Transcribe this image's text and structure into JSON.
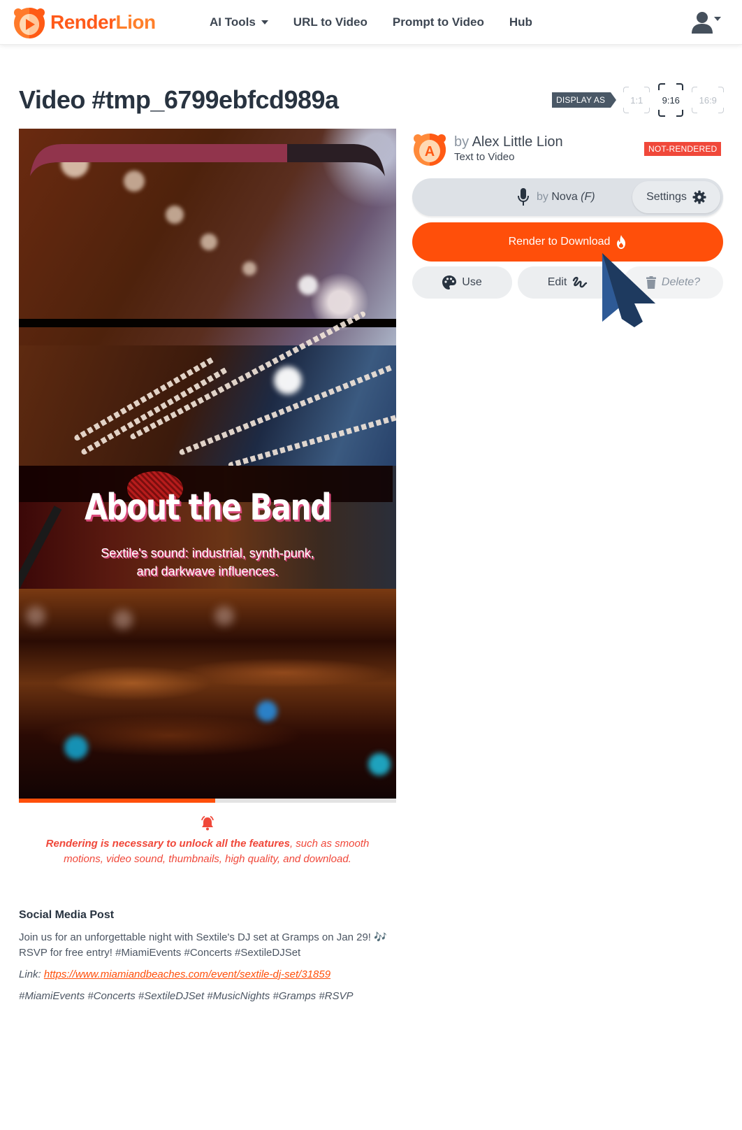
{
  "brand": {
    "name_part1": "Render",
    "name_part2": "Lion",
    "primary_color": "#ff4f0a",
    "text_color": "#283340"
  },
  "nav": {
    "items": [
      {
        "label": "AI Tools",
        "has_dropdown": true
      },
      {
        "label": "URL to Video",
        "has_dropdown": false
      },
      {
        "label": "Prompt to Video",
        "has_dropdown": false
      },
      {
        "label": "Hub",
        "has_dropdown": false
      }
    ],
    "user_icon": "user-icon"
  },
  "page": {
    "title": "Video #tmp_6799ebfcd989a"
  },
  "display_as": {
    "label": "DISPLAY AS",
    "options": [
      "1:1",
      "9:16",
      "16:9"
    ],
    "selected": "9:16"
  },
  "video_preview": {
    "overlay_title": "About the Band",
    "overlay_subtitle_line1": "Sextile's sound: industrial, synth-punk,",
    "overlay_subtitle_line2": "and darkwave influences.",
    "progress_fraction": 0.52
  },
  "author": {
    "by_prefix": "by",
    "name": "Alex Little Lion",
    "avatar_letter": "A",
    "type": "Text to Video",
    "status": "NOT-RENDERED",
    "status_color": "#f0483a"
  },
  "voice": {
    "by_prefix": "by",
    "name": "Nova",
    "gender": "(F)",
    "settings_label": "Settings",
    "mic_icon": "microphone-icon",
    "settings_icon": "gear-icon"
  },
  "actions": {
    "render_label": "Render to Download",
    "render_icon": "fire-icon",
    "use_label": "Use",
    "use_icon": "palette-icon",
    "edit_label": "Edit",
    "edit_icon": "signature-icon",
    "delete_label": "Delete?",
    "delete_icon": "trash-icon"
  },
  "notice": {
    "icon": "bell-icon",
    "bold_text": "Rendering is necessary to unlock all the features",
    "rest_text": ", such as smooth motions, video sound, thumbnails, high quality, and download."
  },
  "social": {
    "heading": "Social Media Post",
    "body": "Join us for an unforgettable night with Sextile's DJ set at Gramps on Jan 29! 🎶 RSVP for free entry! #MiamiEvents #Concerts #SextileDJSet",
    "link_label": "Link:",
    "link_url": "https://www.miamiandbeaches.com/event/sextile-dj-set/31859",
    "hashtags": "#MiamiEvents #Concerts #SextileDJSet #MusicNights #Gramps #RSVP"
  }
}
